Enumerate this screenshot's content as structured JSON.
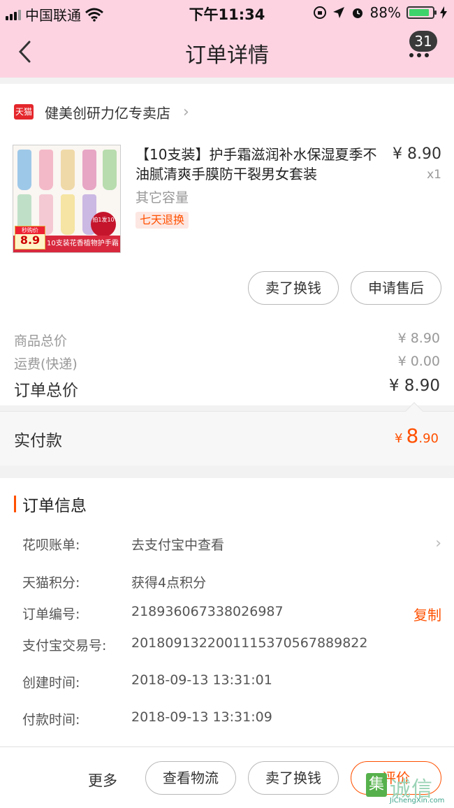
{
  "status_bar": {
    "carrier": "中国联通",
    "time": "下午11:34",
    "battery_pct": "88%",
    "battery_level": 0.88
  },
  "nav": {
    "title": "订单详情",
    "badge_count": "31"
  },
  "shop": {
    "badge": "天猫",
    "name": "健美创研力亿专卖店"
  },
  "product": {
    "title": "【10支装】护手霜滋润补水保湿夏季不油腻清爽手膜防干裂男女套装",
    "price": "¥ 8.90",
    "qty": "x1",
    "spec": "其它容量",
    "return_tag": "七天退换",
    "image_banner": "10支装花香植物护手霜",
    "image_price_label": "秒购价",
    "image_price": "8.9",
    "image_stamp": "拍1发10"
  },
  "item_actions": {
    "sell": "卖了换钱",
    "after_sale": "申请售后"
  },
  "summary": {
    "goods_label": "商品总价",
    "goods_value": "¥ 8.90",
    "shipping_label": "运费(快递)",
    "shipping_value": "¥ 0.00",
    "total_label": "订单总价",
    "total_value": "¥ 8.90"
  },
  "paid": {
    "label": "实付款",
    "currency": "¥",
    "integer": "8",
    "decimal": ".90"
  },
  "order_info": {
    "title": "订单信息",
    "rows": [
      {
        "key": "花呗账单:",
        "value": "去支付宝中查看"
      },
      {
        "key": "天猫积分:",
        "value": "获得4点积分"
      },
      {
        "key": "订单编号:",
        "value": "218936067338026987",
        "action": "复制"
      },
      {
        "key": "支付宝交易号:",
        "value": "2018091322001115370567889822"
      },
      {
        "key": "创建时间:",
        "value": "2018-09-13 13:31:01"
      },
      {
        "key": "付款时间:",
        "value": "2018-09-13 13:31:09"
      }
    ]
  },
  "bottom_bar": {
    "more": "更多",
    "logistics": "查看物流",
    "sell": "卖了换钱",
    "review": "评价"
  },
  "watermark": {
    "logo": "集",
    "text": "诚信",
    "url": "JiChengXin.com"
  },
  "colors": {
    "header_bg": "#fdd3e2",
    "accent": "#ff5000",
    "tmall_red": "#e4272c"
  }
}
